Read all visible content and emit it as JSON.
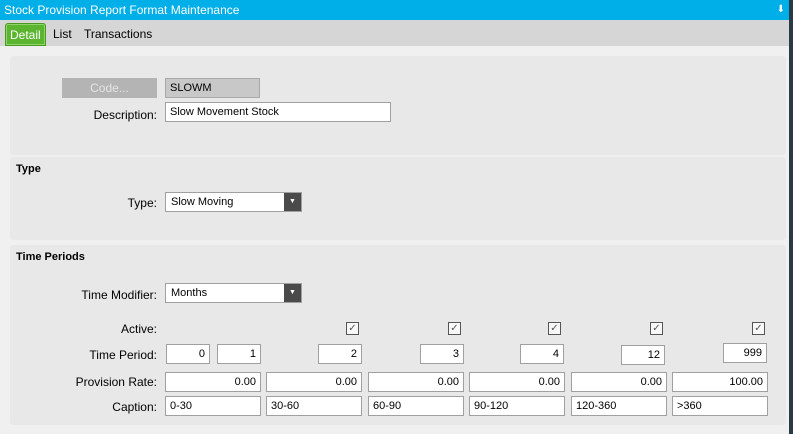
{
  "window": {
    "title": "Stock Provision Report Format Maintenance",
    "pin_icon": "pin-icon"
  },
  "tabs": [
    "Detail",
    "List",
    "Transactions"
  ],
  "header": {
    "code_button": "Code...",
    "code_value": "SLOWM",
    "description_label": "Description:",
    "description_value": "Slow Movement Stock"
  },
  "type_section": {
    "title": "Type",
    "type_label": "Type:",
    "type_value": "Slow Moving"
  },
  "time_periods": {
    "title": "Time Periods",
    "modifier_label": "Time Modifier:",
    "modifier_value": "Months",
    "active_label": "Active:",
    "period_label": "Time Period:",
    "rate_label": "Provision Rate:",
    "caption_label": "Caption:",
    "start_period": "0",
    "columns": [
      {
        "active": true,
        "period": "1",
        "rate": "0.00",
        "caption": "0-30"
      },
      {
        "active": true,
        "period": "2",
        "rate": "0.00",
        "caption": "30-60"
      },
      {
        "active": true,
        "period": "3",
        "rate": "0.00",
        "caption": "60-90"
      },
      {
        "active": true,
        "period": "4",
        "rate": "0.00",
        "caption": "90-120"
      },
      {
        "active": true,
        "period": "12",
        "rate": "0.00",
        "caption": "120-360"
      },
      {
        "active": true,
        "period": "999",
        "rate": "100.00",
        "caption": ">360"
      }
    ]
  }
}
